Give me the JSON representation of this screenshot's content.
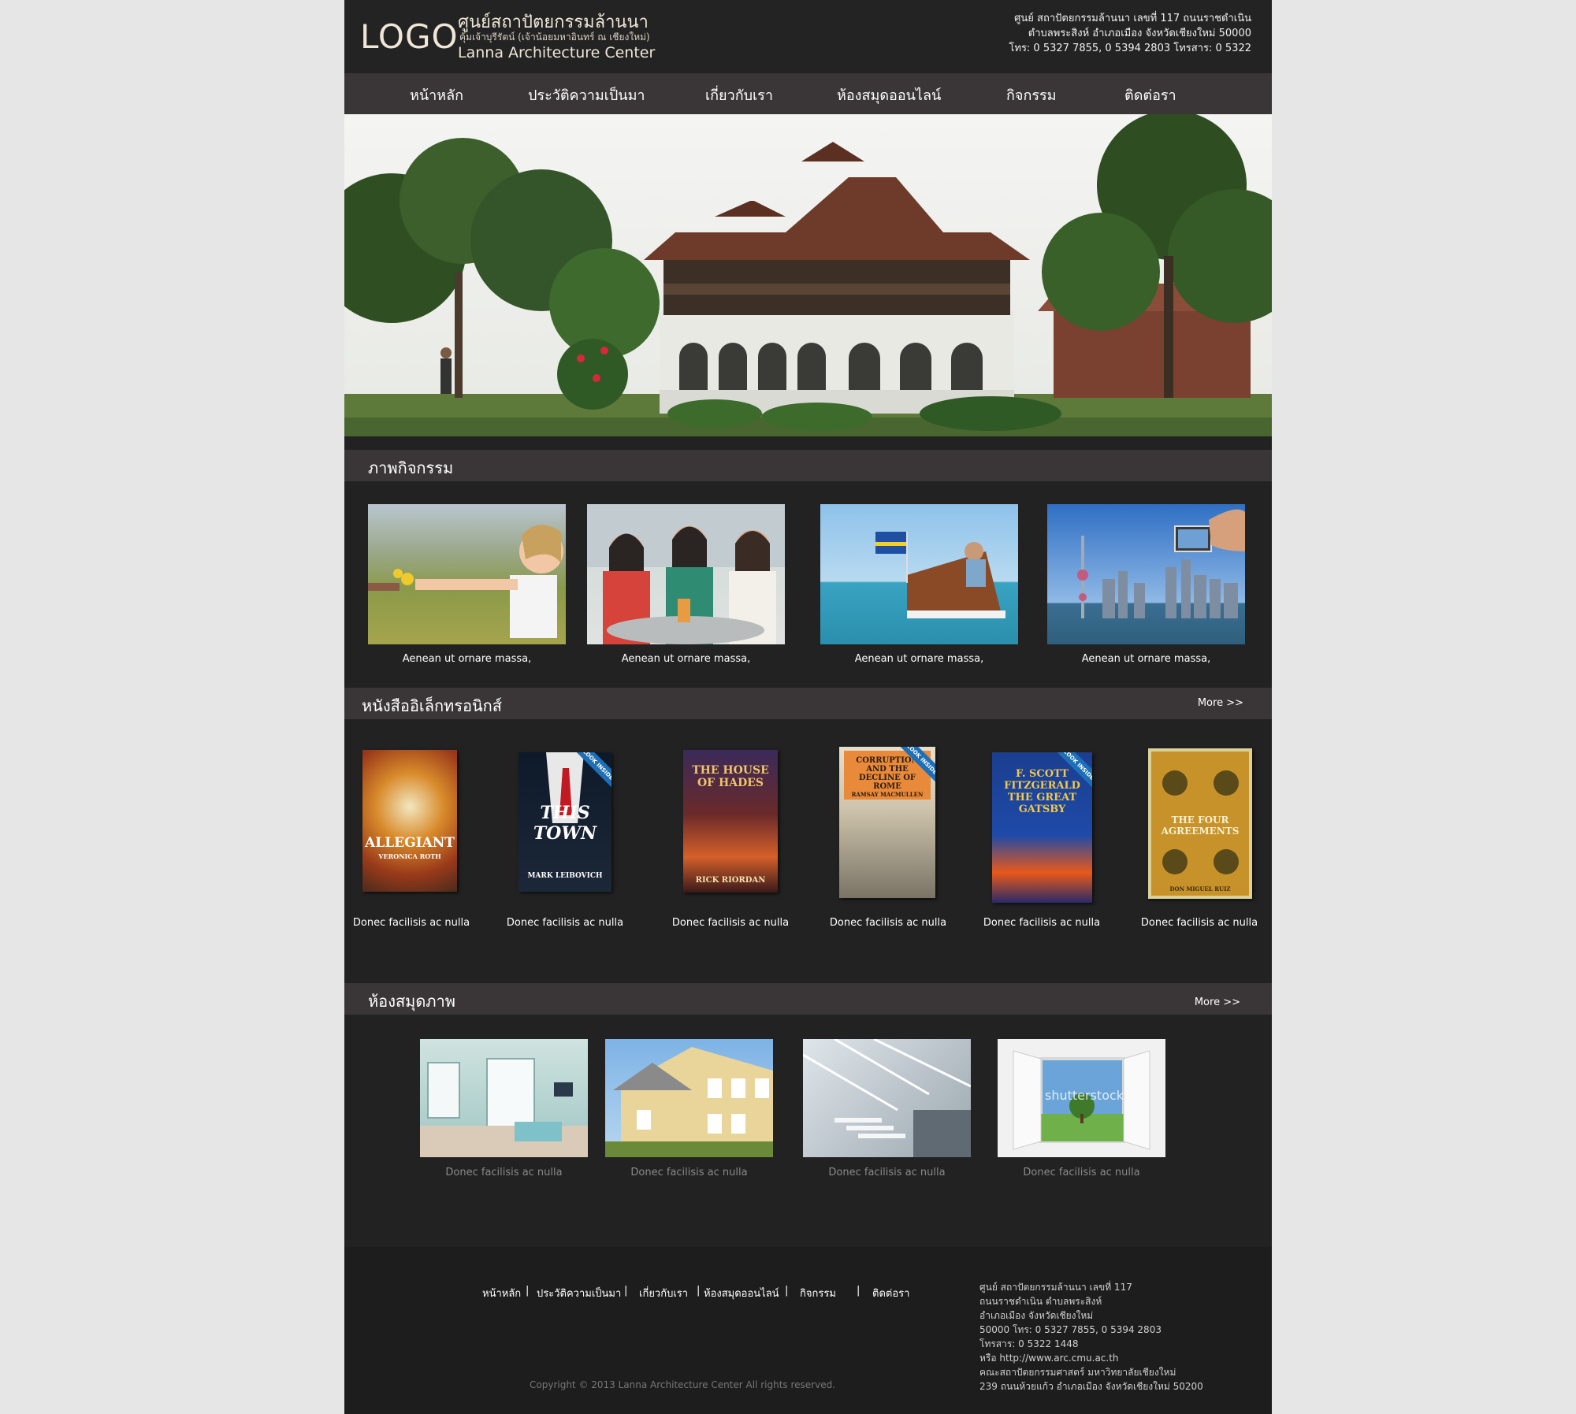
{
  "header": {
    "logo": "LOGO",
    "brand_th": "ศูนย์สถาปัตยกรรมล้านนา",
    "brand_sub": "คุ้มเจ้าบุรีรัตน์ (เจ้าน้อยมหาอินทร์ ณ เชียงใหม่)",
    "brand_en": "Lanna Architecture Center",
    "address_line1": "ศูนย์ สถาปัตยกรรมล้านนา เลขที่ 117 ถนนราชดำเนิน",
    "address_line2": "ตำบลพระสิงห์ อำเภอเมือง จังหวัดเชียงใหม่ 50000",
    "address_line3": "โทร: 0 5327 7855, 0 5394 2803 โทรสาร: 0 5322"
  },
  "nav": {
    "items": [
      "หน้าหลัก",
      "ประวัติความเป็นมา",
      "เกี่ยวกับเรา",
      "ห้องสมุดออนไลน์",
      "กิจกรรม",
      "ติดต่อรา"
    ]
  },
  "activities": {
    "title": "ภาพกิจกรรม",
    "items": [
      {
        "caption": "Aenean ut ornare massa,"
      },
      {
        "caption": "Aenean ut ornare massa,"
      },
      {
        "caption": "Aenean ut ornare massa,"
      },
      {
        "caption": "Aenean ut ornare massa,"
      }
    ]
  },
  "ebooks": {
    "title": "หนังสืออิเล็กทรอนิกส์",
    "more": "More >>",
    "items": [
      {
        "caption": "Donec facilisis ac nulla",
        "cover_title": "ALLEGIANT",
        "cover_author": "VERONICA ROTH"
      },
      {
        "caption": "Donec facilisis ac nulla",
        "cover_title": "THIS TOWN",
        "cover_author": "MARK LEIBOVICH",
        "badge": "LOOK INSIDE"
      },
      {
        "caption": "Donec facilisis ac nulla",
        "cover_title": "THE HOUSE OF HADES",
        "cover_author": "RICK RIORDAN"
      },
      {
        "caption": "Donec facilisis ac nulla",
        "cover_title": "CORRUPTION AND THE DECLINE OF ROME",
        "cover_author": "RAMSAY MACMULLEN",
        "badge": "LOOK INSIDE"
      },
      {
        "caption": "Donec facilisis ac nulla",
        "cover_title": "F. SCOTT FITZGERALD THE GREAT GATSBY",
        "cover_author": "",
        "badge": "LOOK INSIDE"
      },
      {
        "caption": "Donec facilisis ac nulla",
        "cover_title": "THE FOUR AGREEMENTS",
        "cover_author": "DON MIGUEL RUIZ"
      }
    ]
  },
  "gallery": {
    "title": "ห้องสมุดภาพ",
    "more": "More >>",
    "items": [
      {
        "caption": "Donec facilisis ac nulla"
      },
      {
        "caption": "Donec facilisis ac nulla"
      },
      {
        "caption": "Donec facilisis ac nulla"
      },
      {
        "caption": "Donec facilisis ac nulla",
        "watermark": "shutterstock"
      }
    ]
  },
  "footer": {
    "links": [
      "หน้าหลัก",
      "ประวัติความเป็นมา",
      "เกี่ยวกับเรา",
      "ห้องสมุดออนไลน์",
      "กิจกรรม",
      "ติดต่อรา"
    ],
    "separator": "|",
    "address": [
      "ศูนย์ สถาปัตยกรรมล้านนา เลขที่ 117",
      "ถนนราชดำเนิน ตำบลพระสิงห์",
      "อำเภอเมือง จังหวัดเชียงใหม่",
      "50000 โทร: 0 5327 7855, 0 5394 2803",
      "โทรสาร: 0 5322 1448",
      "หรือ http://www.arc.cmu.ac.th",
      "คณะสถาปัตยกรรมศาสตร์ มหาวิทยาลัยเชียงใหม่",
      "239 ถนนห้วยแก้ว อำเภอเมือง จังหวัดเชียงใหม่ 50200"
    ],
    "copyright": "Copyright © 2013 Lanna Architecture Center   All rights reserved."
  }
}
